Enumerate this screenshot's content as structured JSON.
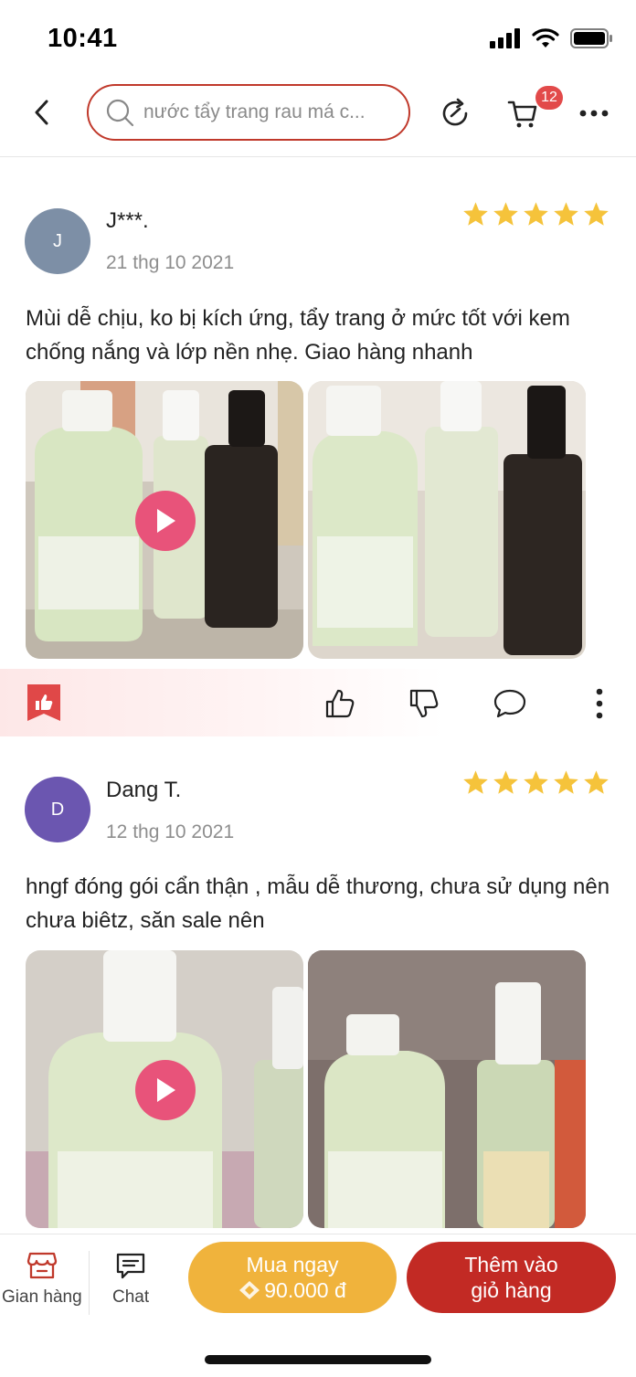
{
  "status_bar": {
    "time": "10:41"
  },
  "nav": {
    "search_placeholder": "nước tẩy trang rau má c...",
    "cart_count": "12"
  },
  "reviews": [
    {
      "avatar_letter": "J",
      "avatar_color": "#7d8fa6",
      "name": "J***.",
      "date": "21 thg 10 2021",
      "rating": 5,
      "text": "Mùi dễ chịu, ko bị kích ứng, tẩy trang ở mức tốt với kem chống nắng và lớp nền nhẹ. Giao hàng nhanh",
      "media": [
        "video",
        "photo"
      ]
    },
    {
      "avatar_letter": "D",
      "avatar_color": "#6b56b0",
      "name": "Dang T.",
      "date": "12 thg 10 2021",
      "rating": 5,
      "text": "hngf đóng gói cẩn thận , mẫu dễ thương, chưa sử dụng nên chưa biêtz, săn sale nên",
      "media": [
        "video",
        "photo"
      ]
    }
  ],
  "bottom_bar": {
    "shop_label": "Gian hàng",
    "chat_label": "Chat",
    "buy_now_label": "Mua ngay",
    "buy_now_price": "90.000 đ",
    "add_to_cart_line1": "Thêm vào",
    "add_to_cart_line2": "giỏ hàng"
  },
  "colors": {
    "accent_red": "#c22a24",
    "accent_orange": "#f0b33c",
    "star": "#f5c33b",
    "play": "#e8537a"
  }
}
